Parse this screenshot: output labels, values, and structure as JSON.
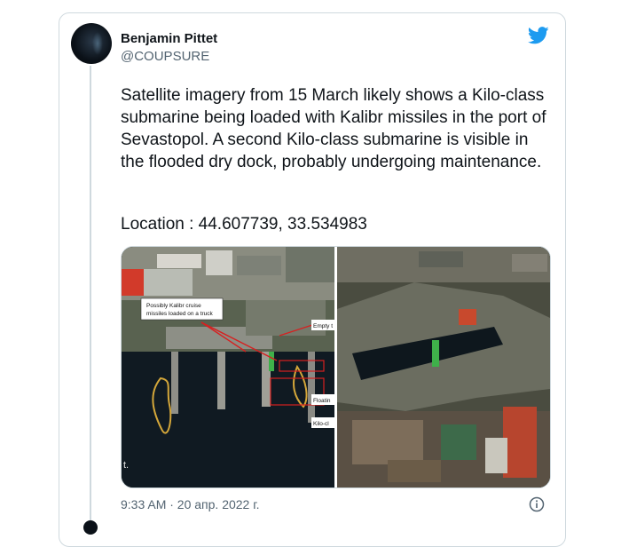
{
  "tweet": {
    "author_name": "Benjamin Pittet",
    "author_handle": "@COUPSURE",
    "text": "Satellite imagery from 15 March likely shows a Kilo-class submarine being loaded with Kalibr missiles in the port of Sevastopol. A second Kilo-class submarine is visible in the flooded dry dock, probably undergoing maintenance.",
    "location": "Location : 44.607739, 33.534983",
    "timestamp": "9:33 AM · 20 апр. 2022 г."
  },
  "media": {
    "annotation_main": [
      "Possibly Kalibr cruise",
      "missiles loaded on a truck"
    ],
    "annotation_empty": "Empty t",
    "annotation_floating": "Floatin",
    "annotation_kilo": "Kilo-cl",
    "corner_mark": "t."
  },
  "icons": {
    "brand": "twitter-bird-icon",
    "info": "info-icon"
  },
  "colors": {
    "twitter_blue": "#1d9bf0",
    "annotation_red": "#d62020",
    "text_primary": "#0f1419",
    "text_secondary": "#536471"
  }
}
